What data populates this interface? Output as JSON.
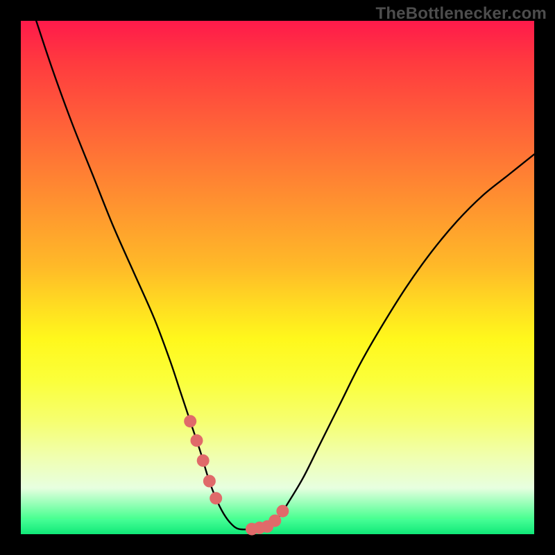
{
  "watermark_text": "TheBottlenecker.com",
  "chart_data": {
    "type": "line",
    "title": "",
    "xlabel": "",
    "ylabel": "",
    "xlim": [
      0,
      100
    ],
    "ylim": [
      0,
      100
    ],
    "x": [
      3,
      6,
      10,
      14,
      18,
      22,
      26,
      29,
      31,
      33,
      35,
      36.5,
      38,
      39.5,
      41,
      42.5,
      45,
      48,
      50,
      52,
      55,
      58,
      62,
      66,
      70,
      75,
      80,
      85,
      90,
      95,
      100
    ],
    "values": [
      100,
      91,
      80,
      70,
      60,
      51,
      42,
      34,
      28,
      22,
      16,
      11,
      7,
      4,
      2,
      1,
      1,
      1.5,
      3,
      6,
      11,
      17,
      25,
      33,
      40,
      48,
      55,
      61,
      66,
      70,
      74
    ],
    "annotations": {
      "marker_color": "#e06a6a",
      "marker_x_ranges": [
        [
          33,
          38
        ],
        [
          45,
          51
        ]
      ],
      "gradient_stops": [
        {
          "pos": 0.0,
          "color": "#ff1a4b"
        },
        {
          "pos": 0.5,
          "color": "#ffda22"
        },
        {
          "pos": 0.78,
          "color": "#fbff6a"
        },
        {
          "pos": 1.0,
          "color": "#10e878"
        }
      ]
    }
  },
  "colors": {
    "frame_background": "#000000",
    "curve_stroke": "#000000",
    "watermark": "#4d4d4d"
  }
}
